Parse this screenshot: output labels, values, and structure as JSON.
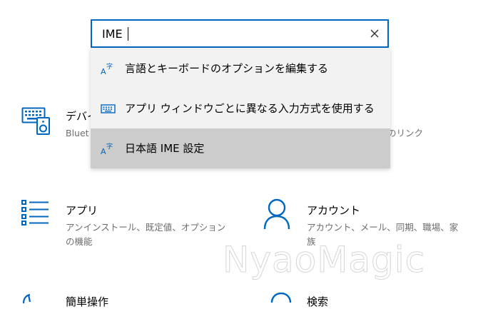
{
  "search": {
    "value": "IME",
    "clear_icon": "close-icon"
  },
  "suggestions": [
    {
      "label": "言語とキーボードのオプションを編集する",
      "icon": "language-icon",
      "selected": false
    },
    {
      "label": "アプリ ウィンドウごとに異なる入力方式を使用する",
      "icon": "keyboard-icon",
      "selected": false
    },
    {
      "label": "日本語 IME 設定",
      "icon": "language-icon",
      "selected": true
    }
  ],
  "tiles": {
    "devices": {
      "title": "デバイ",
      "desc_left": "Bluet",
      "desc_right": "のリンク",
      "icon": "devices-icon"
    },
    "apps": {
      "title": "アプリ",
      "desc_line1": "アンインストール、既定値、オプション",
      "desc_line2": "の機能",
      "icon": "apps-list-icon"
    },
    "accounts": {
      "title": "アカウント",
      "desc_line1": "アカウント、メール、同期、職場、家",
      "desc_line2": "族",
      "icon": "person-icon"
    },
    "ease_of_access": {
      "title": "簡単操作",
      "icon": "ease-of-access-icon"
    },
    "search_tile": {
      "title": "検索",
      "icon": "search-icon"
    }
  },
  "watermark": {
    "text": "NyaoMagic"
  },
  "colors": {
    "accent": "#0067c0",
    "dropdown_bg": "#f2f2f2",
    "selected_bg": "#cccccc",
    "desc_text": "#6e6e6e"
  }
}
